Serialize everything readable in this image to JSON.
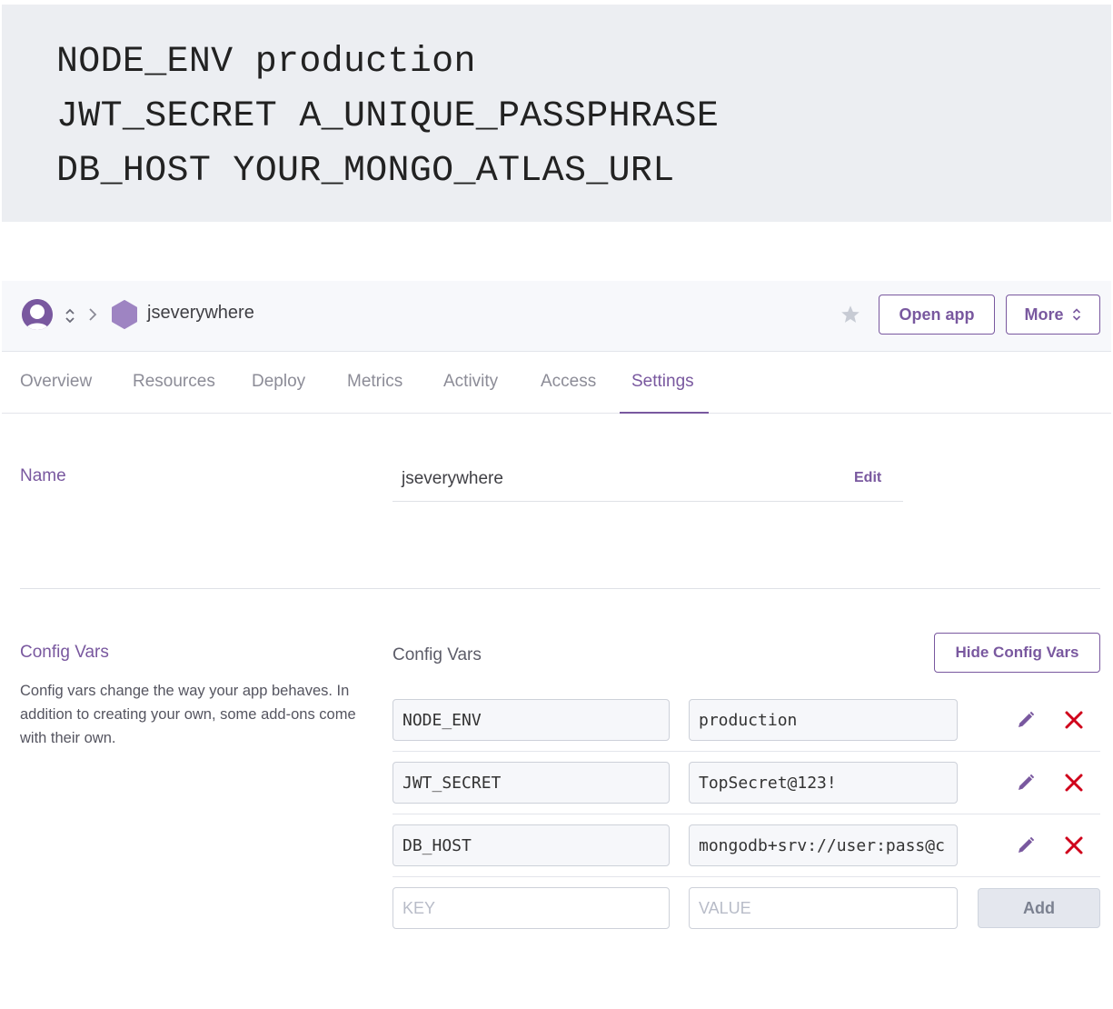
{
  "code_block": {
    "lines": [
      "NODE_ENV production",
      "JWT_SECRET A_UNIQUE_PASSPHRASE",
      "DB_HOST YOUR_MONGO_ATLAS_URL"
    ]
  },
  "header": {
    "app_name": "jseverywhere",
    "open_app_label": "Open app",
    "more_label": "More",
    "icons": [
      "avatar-icon",
      "chevron-updown-icon",
      "chevron-right-icon",
      "hexagon-app-icon",
      "star-icon"
    ]
  },
  "tabs": [
    {
      "label": "Overview"
    },
    {
      "label": "Resources"
    },
    {
      "label": "Deploy"
    },
    {
      "label": "Metrics"
    },
    {
      "label": "Activity"
    },
    {
      "label": "Access"
    },
    {
      "label": "Settings",
      "active": true
    }
  ],
  "name_section": {
    "label": "Name",
    "value": "jseverywhere",
    "edit_label": "Edit"
  },
  "config_vars": {
    "label": "Config Vars",
    "description": "Config vars change the way your app behaves. In addition to creating your own, some add-ons come with their own.",
    "heading": "Config Vars",
    "hide_button_label": "Hide Config Vars",
    "vars": [
      {
        "key": "NODE_ENV",
        "value": "production"
      },
      {
        "key": "JWT_SECRET",
        "value": "TopSecret@123!"
      },
      {
        "key": "DB_HOST",
        "value": "mongodb+srv://user:pass@c"
      }
    ],
    "new_key_placeholder": "KEY",
    "new_value_placeholder": "VALUE",
    "add_label": "Add"
  },
  "colors": {
    "accent": "#79589f",
    "delete": "#d0021b",
    "code_bg": "#eceef2"
  }
}
